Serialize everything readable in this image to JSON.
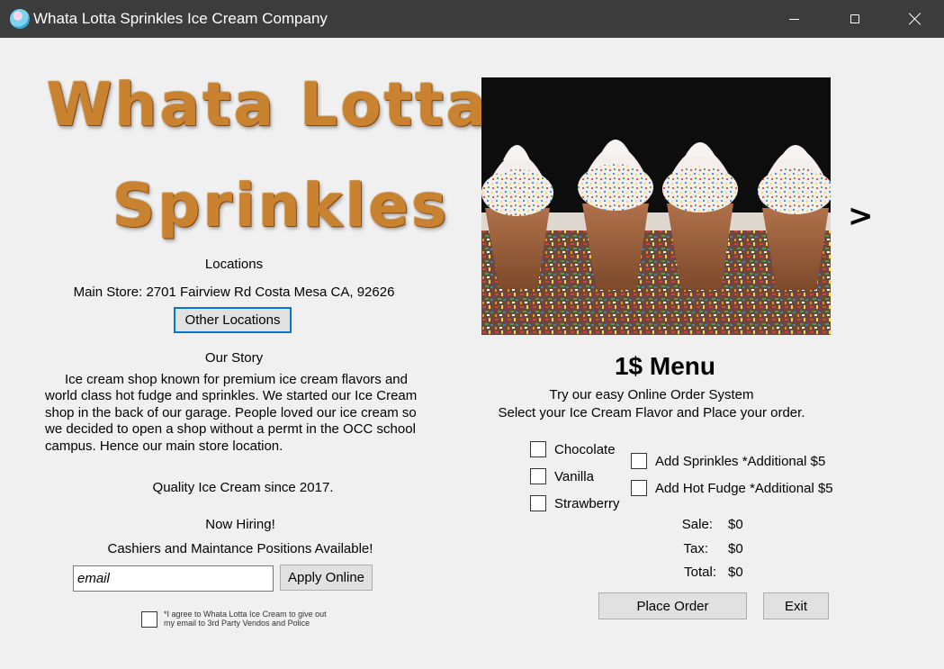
{
  "window": {
    "title": "Whata Lotta Sprinkles Ice Cream Company"
  },
  "logo": {
    "line1": "Whata Lotta",
    "line2": "Sprinkles",
    "color": "#c9822f"
  },
  "locations": {
    "heading": "Locations",
    "main_store": "Main Store: 2701 Fairview Rd Costa Mesa CA, 92626",
    "other_button": "Other Locations"
  },
  "story": {
    "heading": "Our Story",
    "text": "Ice cream shop known for premium ice cream flavors and world class hot fudge and sprinkles. We started our Ice Cream shop in the back of our garage. People loved our ice cream so we decided to open a shop without a permt in the OCC school campus. Hence our main store location.",
    "quality": "Quality Ice Cream since 2017."
  },
  "hiring": {
    "heading": "Now Hiring!",
    "positions": "Cashiers and Maintance Positions Available!",
    "email_placeholder": "email",
    "apply_button": "Apply Online",
    "agree_line1": "*I agree to Whata Lotta Ice Cream to give out",
    "agree_line2": "my email to 3rd Party Vendos and Police"
  },
  "gallery": {
    "next_label": ">"
  },
  "menu": {
    "title": "1$ Menu",
    "subtitle1": "Try our easy Online Order System",
    "subtitle2": "Select your Ice Cream Flavor and Place your order.",
    "flavors": [
      "Chocolate",
      "Vanilla",
      "Strawberry"
    ],
    "toppings": [
      "Add Sprinkles *Additional $5",
      "Add Hot Fudge *Additional $5"
    ],
    "sale_label": "Sale:",
    "sale_value": "$0",
    "tax_label": "Tax:",
    "tax_value": "$0",
    "total_label": "Total:",
    "total_value": "$0",
    "place_order_button": "Place Order",
    "exit_button": "Exit"
  },
  "colors": {
    "titlebar": "#3c3c3c",
    "focus_border": "#0078d7",
    "background": "#f0f0f0"
  }
}
